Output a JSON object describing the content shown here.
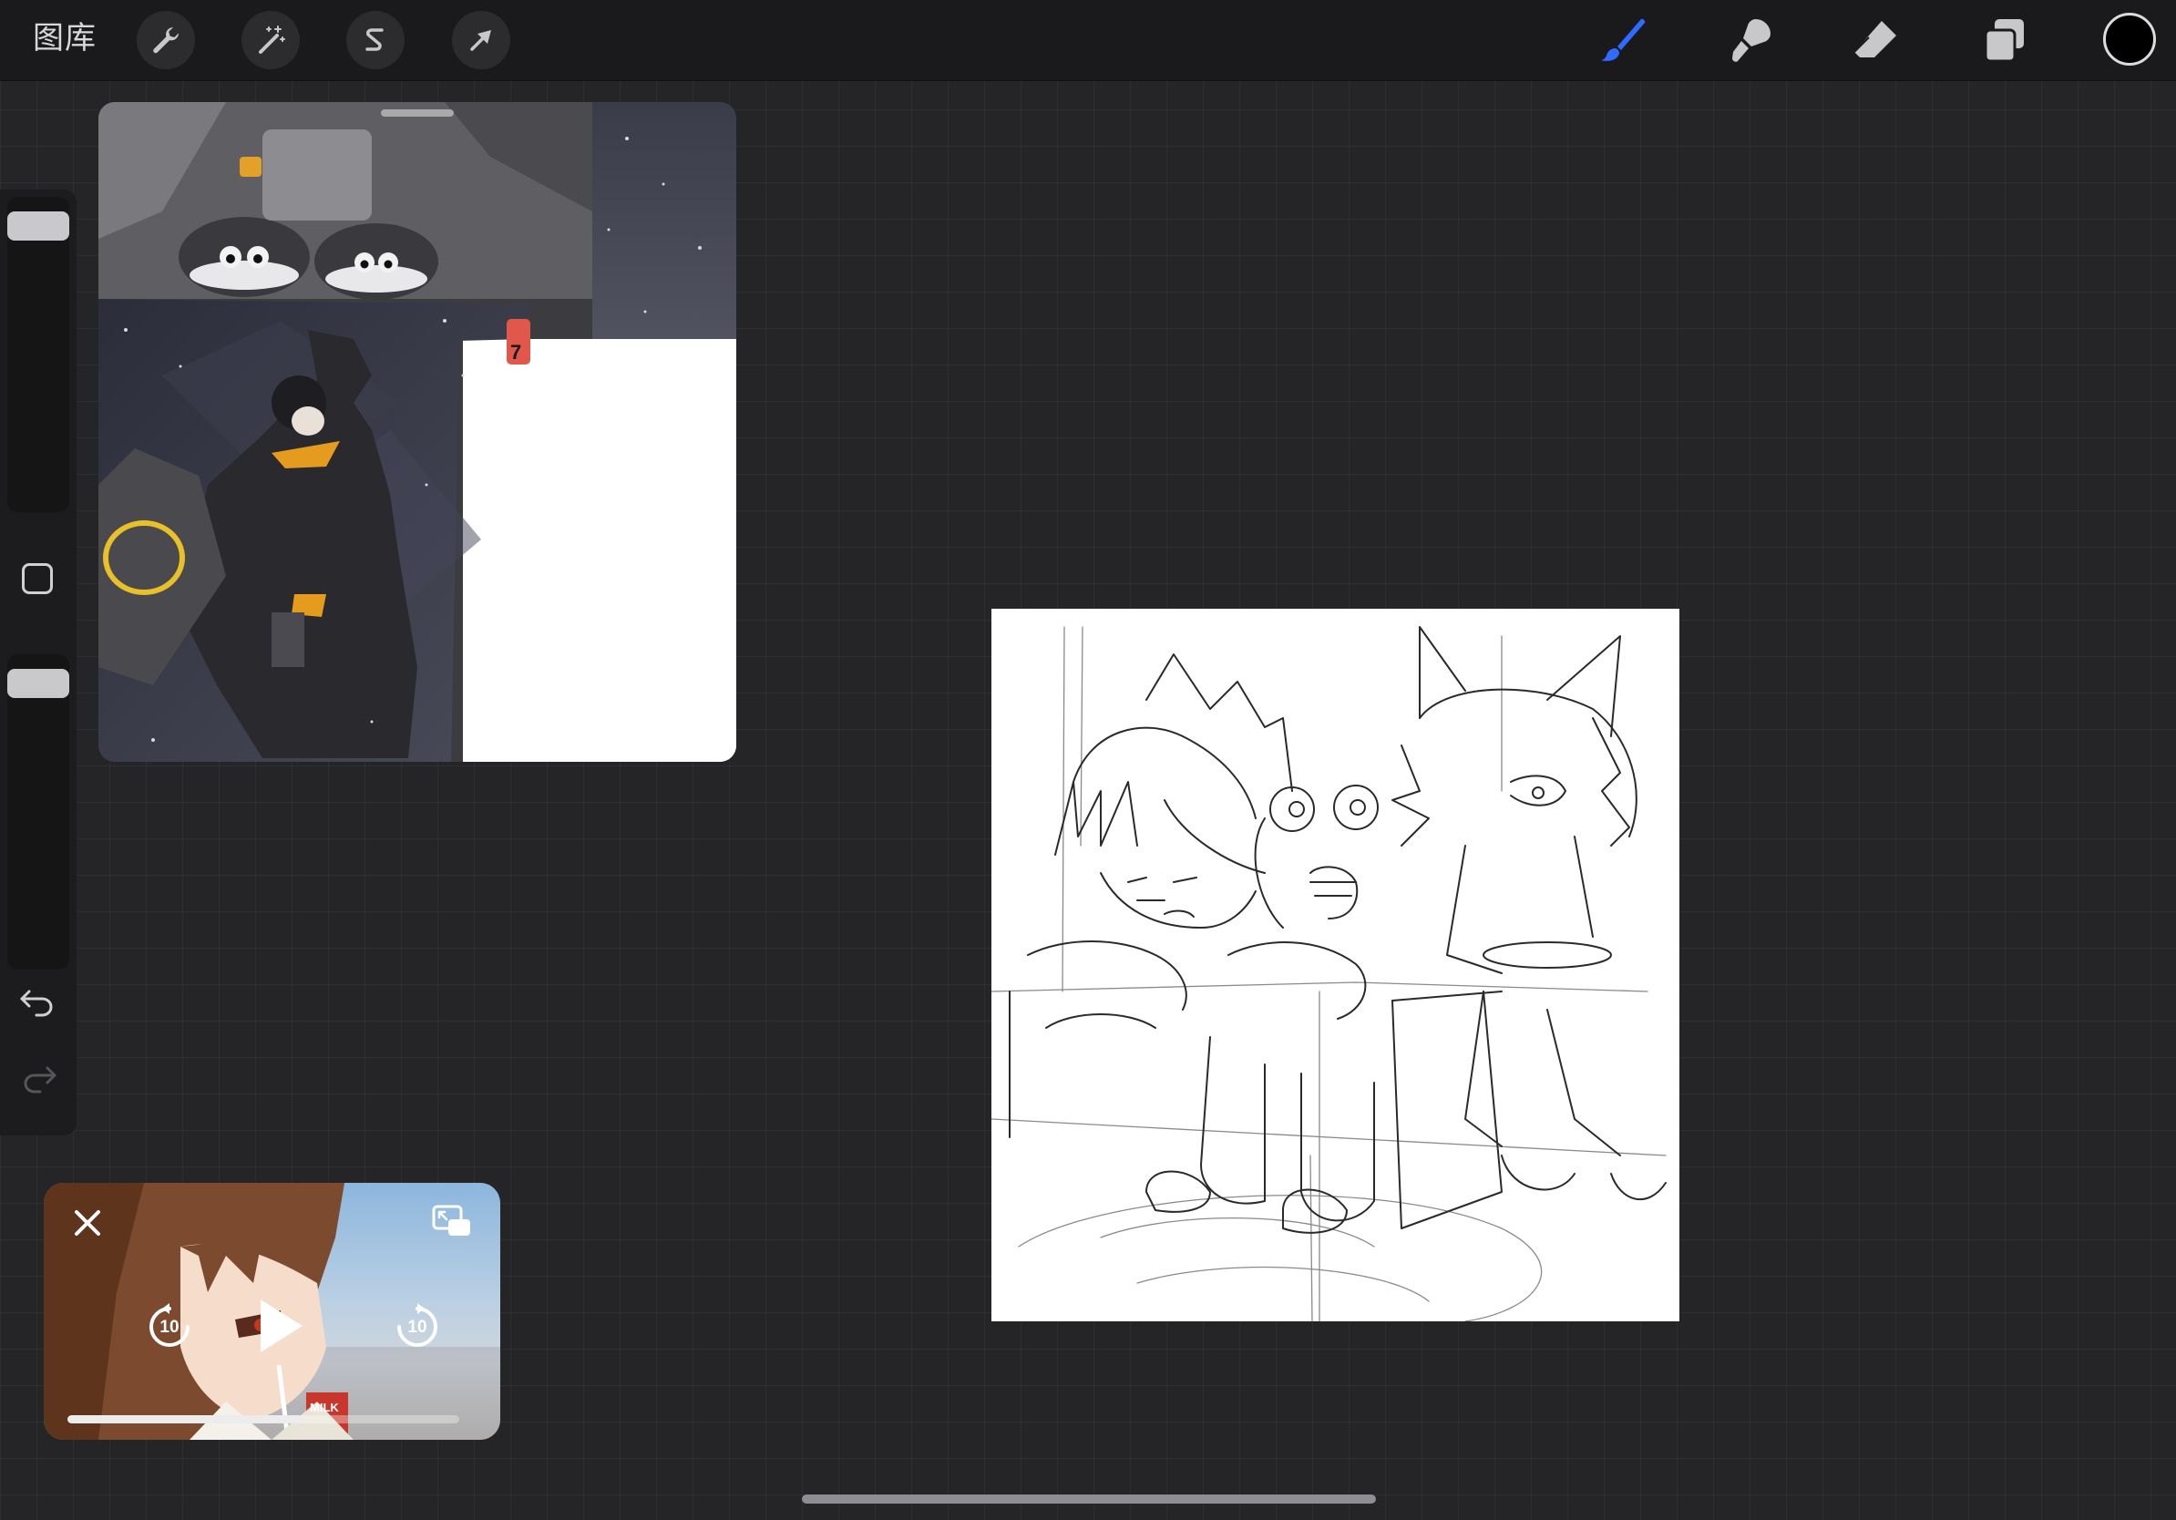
{
  "toolbar": {
    "gallery_label": "图库",
    "left_tools": [
      {
        "name": "actions",
        "icon": "wrench-icon"
      },
      {
        "name": "adjustments",
        "icon": "magic-wand-icon"
      },
      {
        "name": "selection",
        "icon": "selection-s-icon"
      },
      {
        "name": "transform",
        "icon": "arrow-cursor-icon"
      }
    ],
    "right_tools": [
      {
        "name": "brush",
        "icon": "brush-icon",
        "active": true
      },
      {
        "name": "smudge",
        "icon": "smudge-icon",
        "active": false
      },
      {
        "name": "eraser",
        "icon": "eraser-icon",
        "active": false
      },
      {
        "name": "layers",
        "icon": "layers-icon",
        "active": false
      }
    ],
    "accent_color": "#2f6bff",
    "current_color": "#000000"
  },
  "sidebar": {
    "brush_size_level": 0.95,
    "opacity_level": 0.95,
    "modify_button": "square-icon",
    "undo": "undo-icon",
    "redo": "redo-icon"
  },
  "reference_panel": {
    "badge_text": "7"
  },
  "canvas": {
    "content": "pencil-sketch"
  },
  "pip_video": {
    "skip_back_seconds": "10",
    "skip_forward_seconds": "10",
    "progress": 0.6,
    "close_icon": "close-icon",
    "restore_icon": "pip-restore-icon",
    "carton_text": "MILK"
  }
}
